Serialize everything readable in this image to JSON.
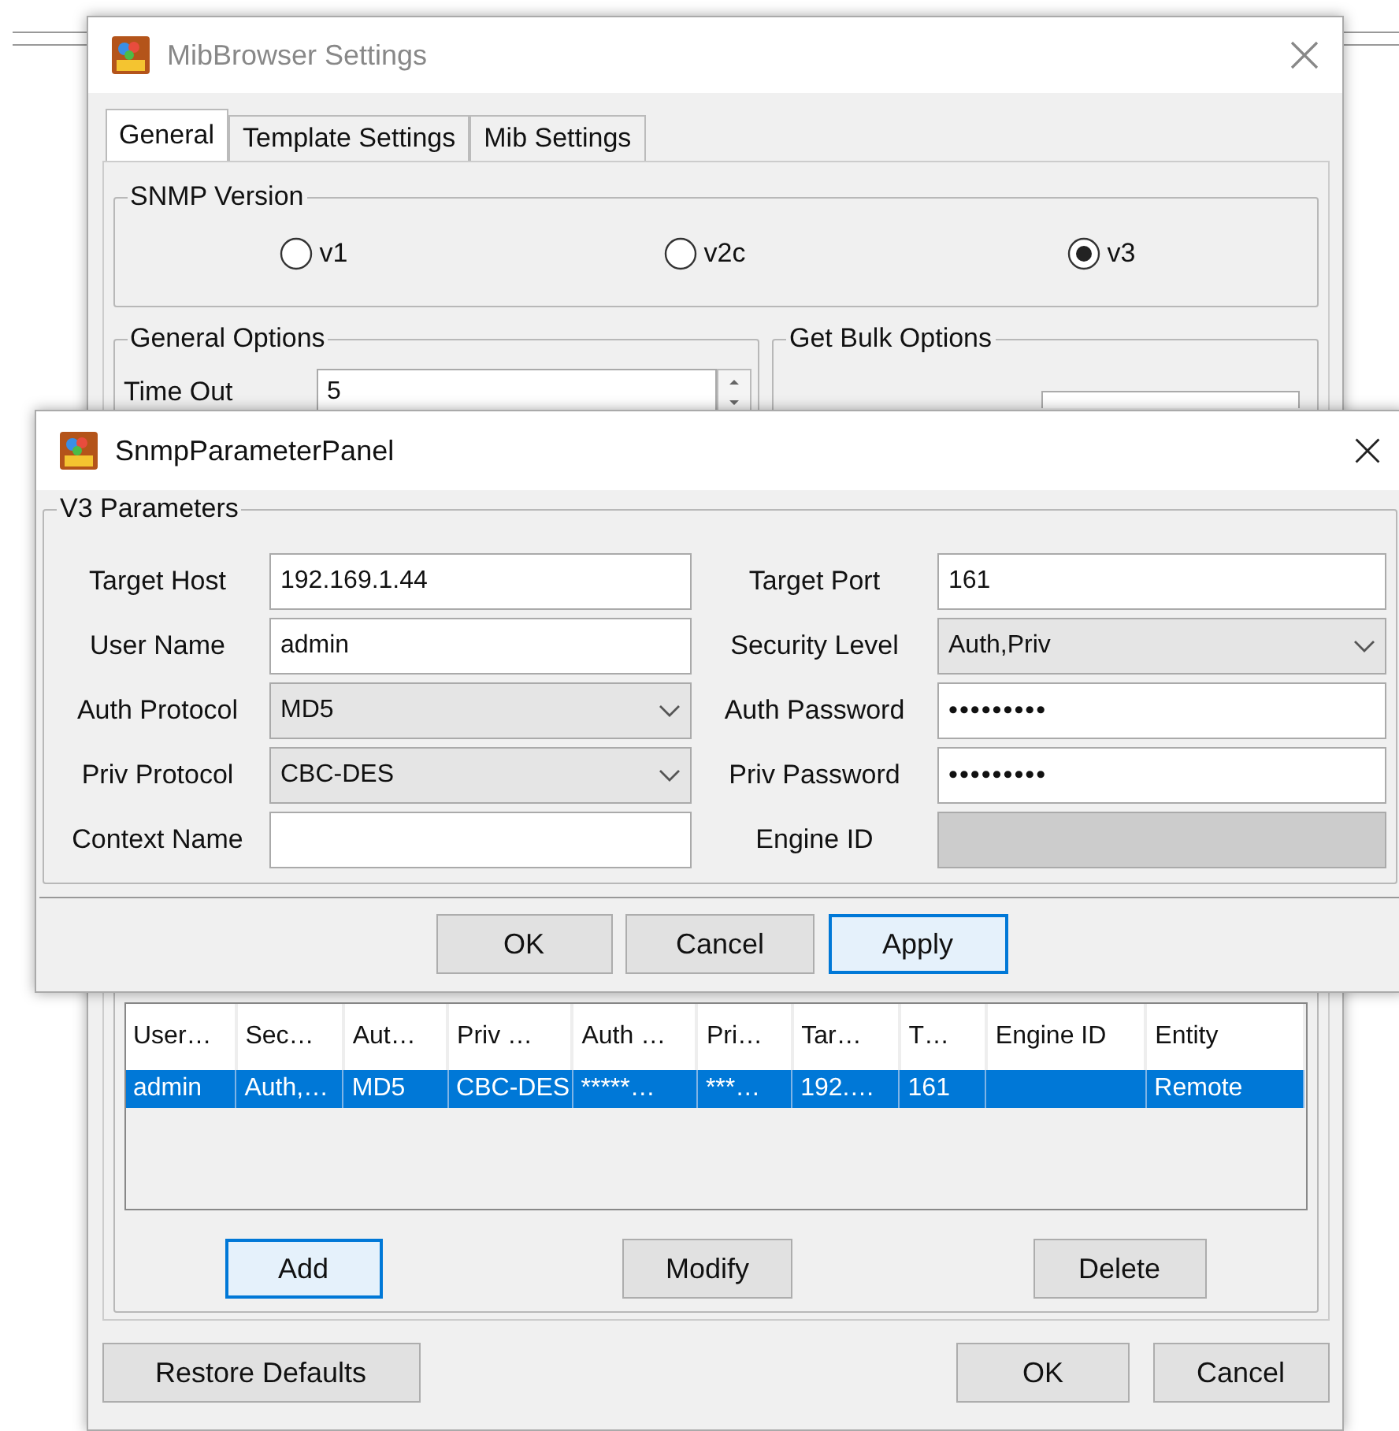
{
  "back_window": {
    "title": "MibBrowser Settings",
    "tabs": [
      {
        "label": "General",
        "selected": true
      },
      {
        "label": "Template Settings",
        "selected": false
      },
      {
        "label": "Mib Settings",
        "selected": false
      }
    ],
    "snmp_version": {
      "title": "SNMP Version",
      "options": [
        {
          "label": "v1",
          "selected": false
        },
        {
          "label": "v2c",
          "selected": false
        },
        {
          "label": "v3",
          "selected": true
        }
      ]
    },
    "general_options": {
      "title": "General Options",
      "time_out": {
        "label": "Time Out",
        "value": "5"
      }
    },
    "get_bulk_options": {
      "title": "Get Bulk Options"
    },
    "table": {
      "columns": [
        "User…",
        "Sec…",
        "Aut…",
        "Priv …",
        "Auth …",
        "Pri…",
        "Tar…",
        "T…",
        "Engine ID",
        "Entity"
      ],
      "rows": [
        {
          "selected": true,
          "cells": [
            "admin",
            "Auth,…",
            "MD5",
            "CBC-DES",
            "*****…",
            "***…",
            "192.…",
            "161",
            null,
            "Remote"
          ]
        }
      ]
    },
    "table_buttons": [
      {
        "label": "Add",
        "focused": true
      },
      {
        "label": "Modify",
        "focused": false
      },
      {
        "label": "Delete",
        "focused": false
      }
    ],
    "buttons": [
      "Restore Defaults",
      "OK",
      "Cancel"
    ]
  },
  "front_window": {
    "title": "SnmpParameterPanel",
    "group_title": "V3 Parameters",
    "fields": [
      {
        "label": "Target Host",
        "kind": "text",
        "value": "192.169.1.44"
      },
      {
        "label": "Target Port",
        "kind": "text",
        "value": "161"
      },
      {
        "label": "User Name",
        "kind": "text",
        "value": "admin"
      },
      {
        "label": "Security Level",
        "kind": "select",
        "value": "Auth,Priv"
      },
      {
        "label": "Auth Protocol",
        "kind": "select",
        "value": "MD5"
      },
      {
        "label": "Auth Password",
        "kind": "password",
        "value": "•••••••••"
      },
      {
        "label": "Priv Protocol",
        "kind": "select",
        "value": "CBC-DES"
      },
      {
        "label": "Priv Password",
        "kind": "password",
        "value": "•••••••••"
      },
      {
        "label": "Context Name",
        "kind": "text"
      },
      {
        "label": "Engine ID",
        "kind": "disabled"
      }
    ],
    "buttons": [
      {
        "label": "OK",
        "focused": false
      },
      {
        "label": "Cancel",
        "focused": false
      },
      {
        "label": "Apply",
        "focused": true
      }
    ]
  }
}
